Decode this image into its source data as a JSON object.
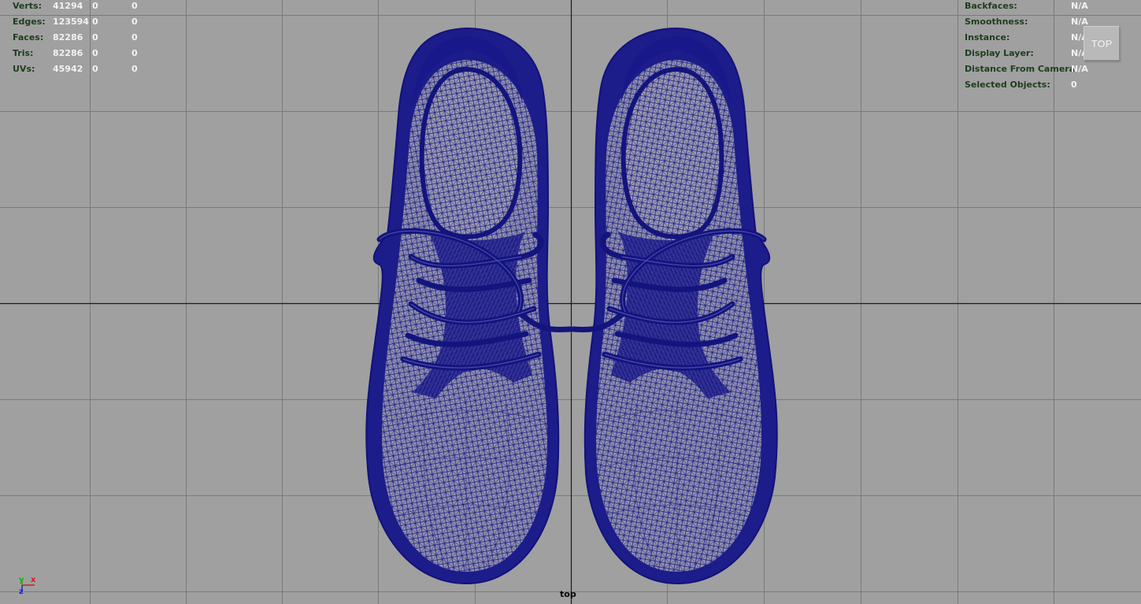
{
  "viewport": {
    "camera_name": "top",
    "viewcube_label": "TOP",
    "colors": {
      "background": "#a0a0a0",
      "grid": "#7a7a7a",
      "axis_lines": "#1a1a1a",
      "wireframe": "#141482",
      "hud_label": "#1e3d1e",
      "hud_value": "#f2f2f2"
    },
    "axis_gizmo": {
      "x": "x",
      "y": "y",
      "z": "z"
    }
  },
  "hud_left": [
    {
      "label": "Verts:",
      "values": [
        "41294",
        "0",
        "0"
      ]
    },
    {
      "label": "Edges:",
      "values": [
        "123594",
        "0",
        "0"
      ]
    },
    {
      "label": "Faces:",
      "values": [
        "82286",
        "0",
        "0"
      ]
    },
    {
      "label": "Tris:",
      "values": [
        "82286",
        "0",
        "0"
      ]
    },
    {
      "label": "UVs:",
      "values": [
        "45942",
        "0",
        "0"
      ]
    }
  ],
  "hud_right": [
    {
      "label": "Backfaces:",
      "value": "N/A"
    },
    {
      "label": "Smoothness:",
      "value": "N/A"
    },
    {
      "label": "Instance:",
      "value": "N/A"
    },
    {
      "label": "Display Layer:",
      "value": "N/A"
    },
    {
      "label": "Distance From Camera:",
      "value": "N/A"
    },
    {
      "label": "Selected Objects:",
      "value": "0"
    }
  ],
  "objects": [
    {
      "name": "left-shoe",
      "display": "wireframe",
      "icon": "shoe-mesh"
    },
    {
      "name": "right-shoe",
      "display": "wireframe",
      "icon": "shoe-mesh"
    }
  ]
}
